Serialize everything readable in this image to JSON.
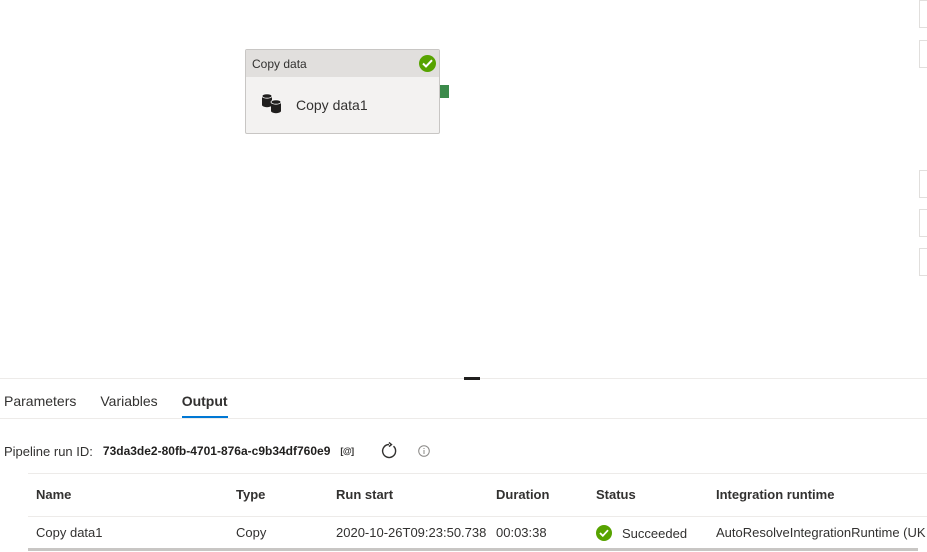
{
  "canvas": {
    "activity": {
      "type_label": "Copy data",
      "name": "Copy data1",
      "status_icon": "check-circle-icon",
      "status_color": "#57a300"
    }
  },
  "tabs": [
    {
      "label": "Parameters",
      "active": false
    },
    {
      "label": "Variables",
      "active": false
    },
    {
      "label": "Output",
      "active": true
    }
  ],
  "run": {
    "label": "Pipeline run ID:",
    "id": "73da3de2-80fb-4701-876a-c9b34df760e9",
    "copy_label": "[@]"
  },
  "table": {
    "columns": [
      "Name",
      "Type",
      "Run start",
      "Duration",
      "Status",
      "Integration runtime"
    ],
    "rows": [
      {
        "name": "Copy data1",
        "type": "Copy",
        "run_start": "2020-10-26T09:23:50.738",
        "duration": "00:03:38",
        "status": "Succeeded",
        "integration_runtime": "AutoResolveIntegrationRuntime (UK"
      }
    ]
  },
  "colors": {
    "accent": "#0078d4",
    "success": "#57a300"
  }
}
